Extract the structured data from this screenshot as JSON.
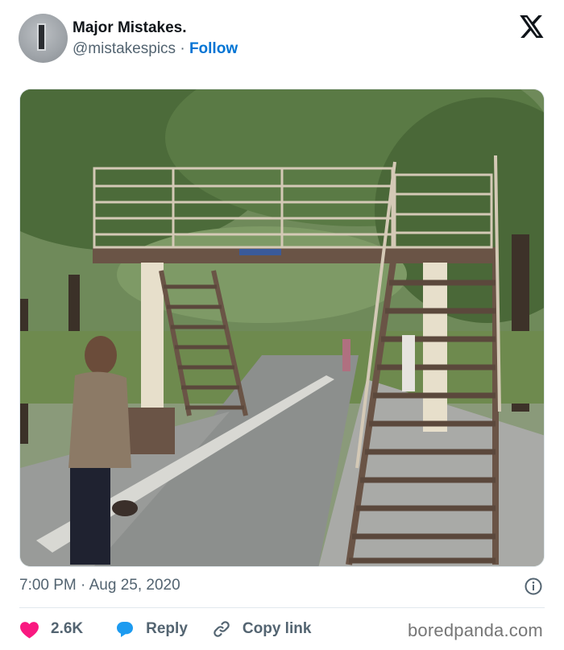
{
  "author": {
    "name": "Major Mistakes.",
    "handle": "@mistakespics",
    "separator": "·",
    "follow_label": "Follow"
  },
  "post": {
    "time": "7:00 PM",
    "date": "Aug 25, 2020",
    "meta_separator": "·"
  },
  "actions": {
    "likes_count": "2.6K",
    "reply_label": "Reply",
    "copy_link_label": "Copy link"
  },
  "watermark": "boredpanda.com",
  "colors": {
    "heart": "#f91880",
    "reply_bubble": "#1d9bf0",
    "follow": "#0074d4",
    "muted": "#536471"
  },
  "icons": {
    "brand": "x-logo-icon",
    "like": "heart-icon",
    "reply": "reply-bubble-icon",
    "copy": "link-icon",
    "info": "info-icon"
  }
}
